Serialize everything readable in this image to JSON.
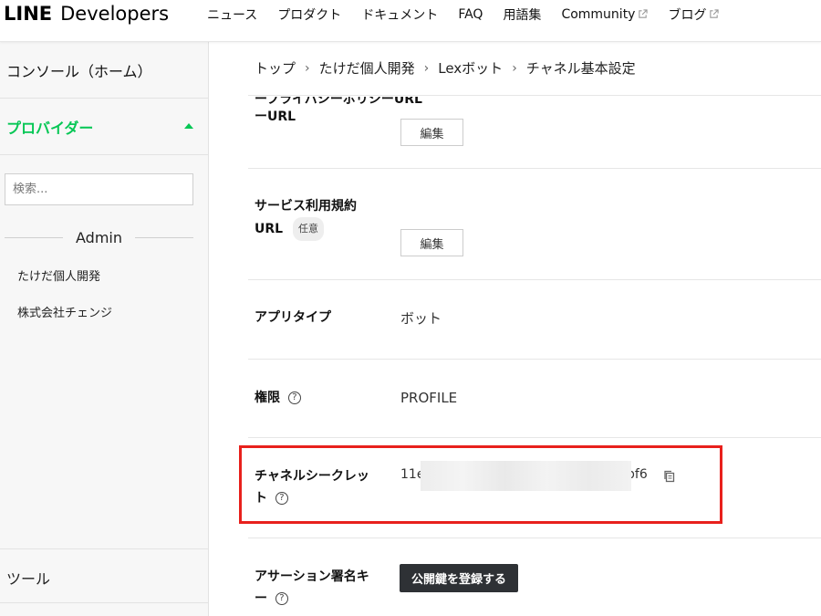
{
  "header": {
    "logo_line": "LINE",
    "logo_developers": "Developers",
    "nav": [
      "ニュース",
      "プロダクト",
      "ドキュメント",
      "FAQ",
      "用語集",
      "Community",
      "ブログ"
    ]
  },
  "sidebar": {
    "console": "コンソール（ホーム）",
    "provider": "プロバイダー",
    "search_placeholder": "検索...",
    "section": "Admin",
    "providers": [
      "たけだ個人開発",
      "株式会社チェンジ"
    ],
    "tools": "ツール"
  },
  "breadcrumb": [
    "トップ",
    "たけだ個人開発",
    "Lexボット",
    "チャネル基本設定"
  ],
  "settings": {
    "privacy_label_partial": "ープライバシーポリシーURL",
    "privacy_label_line2": "ーURL",
    "edit": "編集",
    "terms_label_1": "サービス利用規約",
    "terms_label_2": "URL",
    "optional_badge": "任意",
    "app_type_label": "アプリタイプ",
    "app_type_value": "ボット",
    "permission_label": "権限",
    "permission_value": "PROFILE",
    "secret_label_1": "チャネルシークレッ",
    "secret_label_2": "ト",
    "secret_prefix": "11e",
    "secret_suffix": "bf6",
    "assertion_label_1": "アサーション署名キ",
    "assertion_label_2": "ー",
    "register_key": "公開鍵を登録する",
    "help_glyph": "?"
  },
  "colors": {
    "brand_green": "#06c755",
    "highlight_red": "#e8201c",
    "dark_button": "#2e3135"
  },
  "icons": {
    "external_link": "external-link-icon",
    "copy": "copy-icon",
    "help": "question-circle-icon",
    "caret": "caret-up-icon"
  }
}
